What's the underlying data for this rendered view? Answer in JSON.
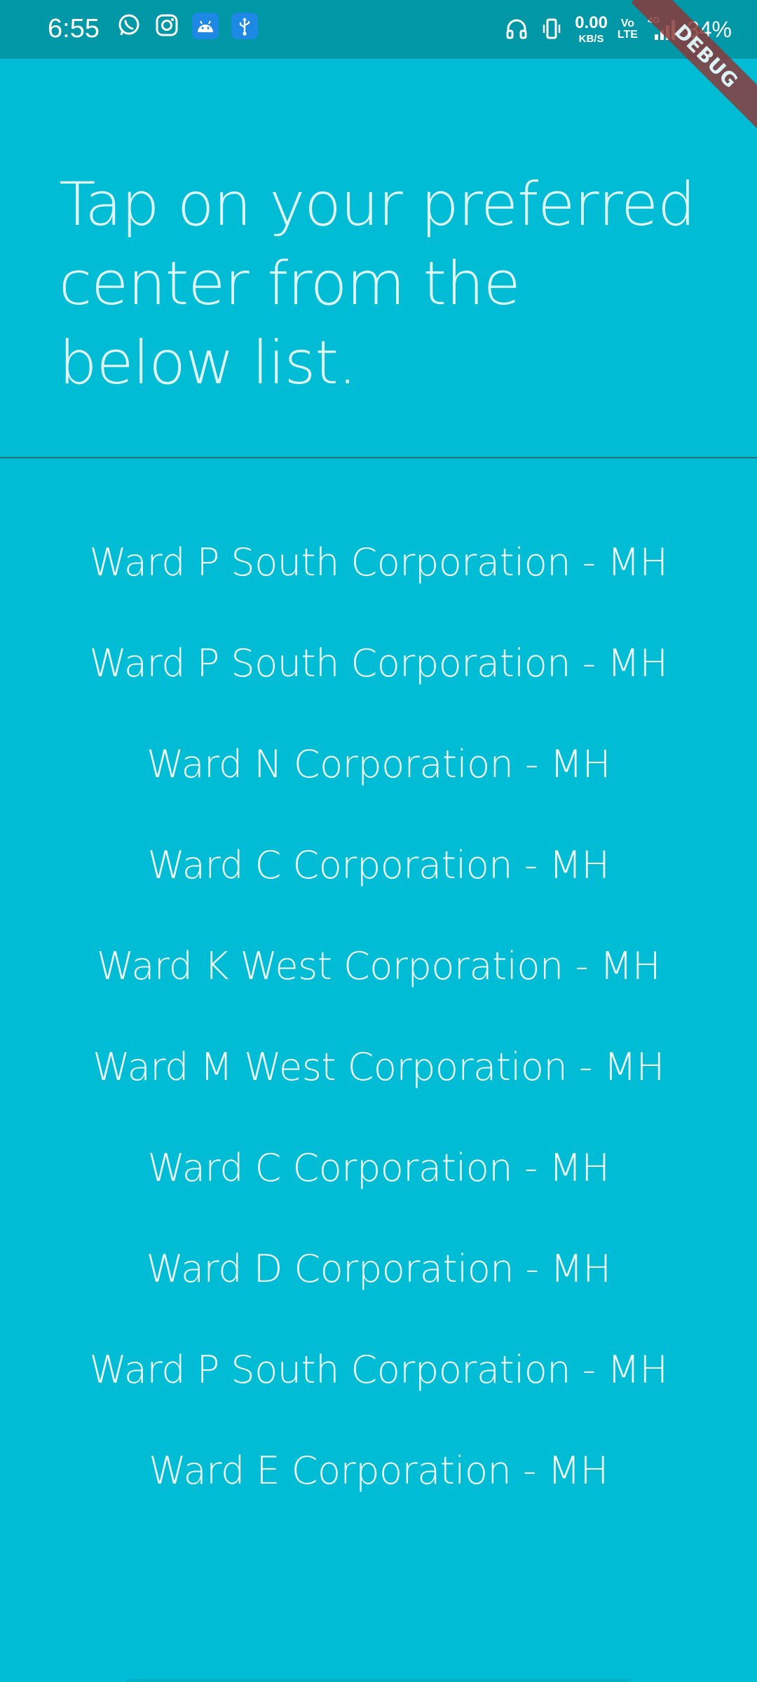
{
  "status_bar": {
    "time": "6:55",
    "left_icons": [
      "whatsapp-icon",
      "instagram-icon",
      "android-debug-icon",
      "usb-icon"
    ],
    "right_icons": [
      "headphones-icon",
      "vibrate-icon",
      "volte-icon",
      "signal-icon"
    ],
    "net_speed_value": "0.00",
    "net_speed_unit": "KB/S",
    "volte_top": "Vo",
    "volte_bottom": "LTE",
    "network_type": "4G",
    "battery": "34%",
    "colors": {
      "background": "#0097A7",
      "android_badge": "#1E88E5"
    }
  },
  "debug_banner": {
    "label": "DEBUG",
    "color": "#8B3A3A"
  },
  "main": {
    "heading": "Tap on your preferred center from the below list.",
    "background_color": "#00BCD4",
    "text_color": "#E0F7FA",
    "centers": [
      "Ward P South Corporation - MH",
      "Ward P South Corporation - MH",
      "Ward N Corporation - MH",
      "Ward C Corporation - MH",
      "Ward K West Corporation - MH",
      "Ward M West Corporation - MH",
      "Ward C Corporation - MH",
      "Ward D Corporation - MH",
      "Ward P South Corporation - MH",
      "Ward E Corporation - MH"
    ]
  }
}
